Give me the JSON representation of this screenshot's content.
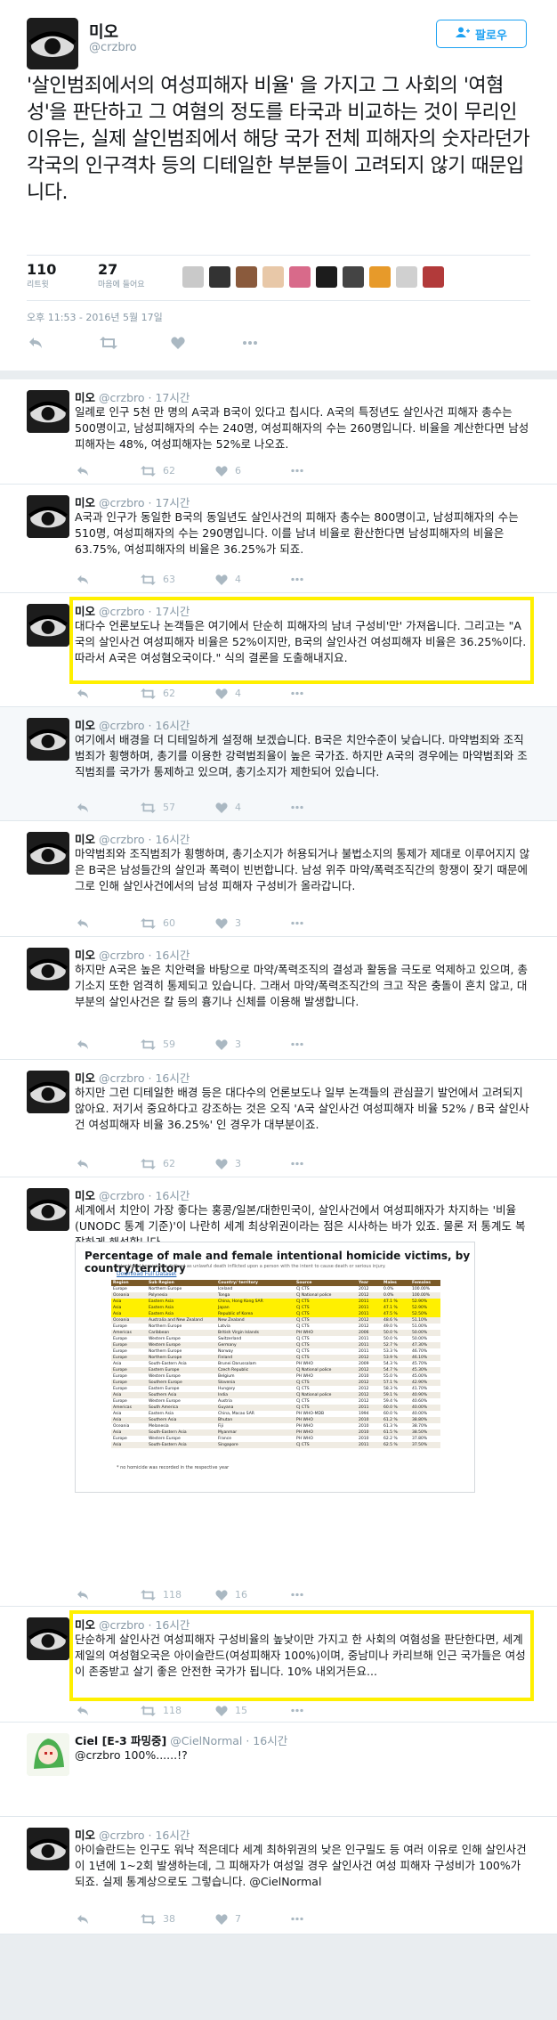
{
  "main_tweet": {
    "name": "미오",
    "handle": "@crzbro",
    "follow_label": "팔로우",
    "text": "'살인범죄에서의 여성피해자 비율' 을 가지고 그 사회의 '여혐성'을 판단하고 그 여혐의 정도를 타국과 비교하는 것이 무리인 이유는, 실제 살인범죄에서 해당 국가 전체 피해자의 숫자라던가 각국의 인구격차 등의 디테일한 부분들이 고려되지 않기 때문입니다.",
    "retweets": "110",
    "retweets_label": "리트윗",
    "likes": "27",
    "likes_label": "마음에 들어요",
    "timestamp": "오후 11:53 - 2016년 5월 17일"
  },
  "replies": [
    {
      "name": "미오",
      "handle": "@crzbro",
      "time": "· 17시간",
      "text": "일례로 인구 5천 만 명의 A국과 B국이 있다고 칩시다. A국의 특정년도 살인사건 피해자 총수는 500명이고, 남성피해자의 수는 240명, 여성피해자의 수는 260명입니다. 비율을 계산한다면 남성피해자는 48%, 여성피해자는 52%로 나오죠.",
      "rt": "62",
      "like": "6"
    },
    {
      "name": "미오",
      "handle": "@crzbro",
      "time": "· 17시간",
      "text": "A국과 인구가 동일한 B국의 동일년도 살인사건의 피해자 총수는 800명이고, 남성피해자의 수는 510명, 여성피해자의 수는 290명입니다. 이를 남녀 비율로 환산한다면 남성피해자의 비율은 63.75%, 여성피해자의 비율은 36.25%가 되죠.",
      "rt": "63",
      "like": "4"
    },
    {
      "name": "미오",
      "handle": "@crzbro",
      "time": "· 17시간",
      "text": "대다수 언론보도나 논객들은 여기에서 단순히 피해자의 남녀 구성비'만' 가져옵니다. 그리고는 \"A국의 살인사건 여성피해자 비율은 52%이지만, B국의 살인사건 여성피해자 비율은 36.25%이다. 따라서 A국은 여성혐오국이다.\" 식의 결론을 도출해내지요.",
      "rt": "62",
      "like": "4"
    },
    {
      "name": "미오",
      "handle": "@crzbro",
      "time": "· 16시간",
      "text": "여기에서 배경을 더 디테일하게 설정해 보겠습니다. B국은 치안수준이 낮습니다. 마약범죄와 조직범죄가 횡행하며, 총기를 이용한 강력범죄율이 높은 국가죠. 하지만 A국의 경우에는 마약범죄와 조직범죄를 국가가 통제하고 있으며, 총기소지가 제한되어 있습니다.",
      "rt": "57",
      "like": "4"
    },
    {
      "name": "미오",
      "handle": "@crzbro",
      "time": "· 16시간",
      "text": "마약범죄와 조직범죄가 횡행하며, 총기소지가 허용되거나 불법소지의 통제가 제대로 이루어지지 않은 B국은 남성들간의 살인과 폭력이 빈번합니다. 남성 위주 마약/폭력조직간의 항쟁이 잦기 때문에 그로 인해 살인사건에서의 남성 피해자 구성비가 올라갑니다.",
      "rt": "60",
      "like": "3"
    },
    {
      "name": "미오",
      "handle": "@crzbro",
      "time": "· 16시간",
      "text": "하지만 A국은 높은 치안력을 바탕으로 마약/폭력조직의 결성과 활동을 극도로 억제하고 있으며, 총기소지 또한 엄격히 통제되고 있습니다. 그래서 마약/폭력조직간의 크고 작은 충돌이 흔치 않고, 대부분의 살인사건은 칼 등의 흉기나 신체를 이용해 발생합니다.",
      "rt": "59",
      "like": "3"
    },
    {
      "name": "미오",
      "handle": "@crzbro",
      "time": "· 16시간",
      "text": "하지만 그런 디테일한 배경 등은 대다수의 언론보도나 일부 논객들의 관심끌기 발언에서 고려되지 않아요. 저기서 중요하다고 강조하는 것은 오직 'A국 살인사건 여성피해자 비율 52% / B국 살인사건 여성피해자 비율 36.25%' 인 경우가 대부분이죠.",
      "rt": "62",
      "like": "3"
    },
    {
      "name": "미오",
      "handle": "@crzbro",
      "time": "· 16시간",
      "text": "세계에서 치안이 가장 좋다는 홍콩/일본/대한민국이, 살인사건에서 여성피해자가 차지하는 '비율(UNODC 통계 기준)'이 나란히 세계 최상위권이라는 점은 시사하는 바가 있죠. 물론 저 통계도 복잡하게 해석합니다",
      "rt": "118",
      "like": "16"
    },
    {
      "name": "미오",
      "handle": "@crzbro",
      "time": "· 16시간",
      "text": "단순하게 살인사건 여성피해자 구성비율의 높낮이만 가지고 한 사회의 여혐성을 판단한다면, 세계 제일의 여성혐오국은 아이슬란드(여성피해자 100%)이며, 중남미나 카리브해 인근 국가들은 여성이 존중받고 살기 좋은 안전한 국가가 됩니다. 10% 내외거든요...",
      "rt": "118",
      "like": "15"
    },
    {
      "name": "Ciel [E-3 파밍중]",
      "handle": "@CielNormal",
      "time": "· 16시간",
      "text": "@crzbro 100%......!?",
      "rt": "",
      "like": ""
    },
    {
      "name": "미오",
      "handle": "@crzbro",
      "time": "· 16시간",
      "text": "아이슬란드는 인구도 워낙 적은데다 세계 최하위권의 낮은 인구밀도 등 여러 이유로 인해 살인사건이 1년에 1~2회 발생하는데, 그 피해자가 여성일 경우 살인사건 여성 피해자 구성비가 100%가 되죠. 실제 통계상으로도 그렇습니다. @CielNormal",
      "rt": "38",
      "like": "7"
    }
  ],
  "table": {
    "title": "Percentage of male and female intentional homicide victims, by country/territory",
    "subtitle": "Intentional homicide is defined as unlawful death inflicted upon a person with the intent to cause death or serious injury.",
    "download": "Download Full Dataset",
    "headers": [
      "Region",
      "Sub Region",
      "Country/ territory",
      "Source",
      "Year",
      "Males",
      "Females"
    ],
    "rows": [
      [
        "Europe",
        "Northern Europe",
        "Iceland",
        "CJ CTS",
        "2012",
        "0.0%",
        "100.00%"
      ],
      [
        "Oceania",
        "Polynesia",
        "Tonga",
        "CJ National police",
        "2012",
        "0.0%",
        "100.00%"
      ],
      [
        "Asia",
        "Eastern Asia",
        "China, Hong Kong SAR",
        "CJ CTS",
        "2011",
        "47.1 %",
        "52.90%"
      ],
      [
        "Asia",
        "Eastern Asia",
        "Japan",
        "CJ CTS",
        "2011",
        "47.1 %",
        "52.90%"
      ],
      [
        "Asia",
        "Eastern Asia",
        "Republic of Korea",
        "CJ CTS",
        "2011",
        "47.5 %",
        "52.50%"
      ],
      [
        "Oceania",
        "Australia and New Zealand",
        "New Zealand",
        "CJ CTS",
        "2012",
        "48.6 %",
        "51.10%"
      ],
      [
        "Europe",
        "Northern Europe",
        "Latvia",
        "CJ CTS",
        "2012",
        "49.0 %",
        "51.00%"
      ],
      [
        "Americas",
        "Caribbean",
        "British Virgin Islands",
        "PH WHO",
        "2006",
        "50.0 %",
        "50.00%"
      ],
      [
        "Europe",
        "Western Europe",
        "Switzerland",
        "CJ CTS",
        "2011",
        "50.0 %",
        "50.00%"
      ],
      [
        "Europe",
        "Western Europe",
        "Germany",
        "CJ CTS",
        "2011",
        "52.7 %",
        "47.30%"
      ],
      [
        "Europe",
        "Northern Europe",
        "Norway",
        "CJ CTS",
        "2011",
        "53.3 %",
        "46.70%"
      ],
      [
        "Europe",
        "Northern Europe",
        "Finland",
        "CJ CTS",
        "2012",
        "53.9 %",
        "46.10%"
      ],
      [
        "Asia",
        "South-Eastern Asia",
        "Brunei Darussalam",
        "PH WHO",
        "2009",
        "54.3 %",
        "45.70%"
      ],
      [
        "Europe",
        "Eastern Europe",
        "Czech Republic",
        "CJ National police",
        "2012",
        "54.7 %",
        "45.30%"
      ],
      [
        "Europe",
        "Western Europe",
        "Belgium",
        "PH WHO",
        "2010",
        "55.0 %",
        "45.00%"
      ],
      [
        "Europe",
        "Southern Europe",
        "Slovenia",
        "CJ CTS",
        "2012",
        "57.1 %",
        "42.90%"
      ],
      [
        "Europe",
        "Eastern Europe",
        "Hungary",
        "CJ CTS",
        "2012",
        "58.3 %",
        "41.70%"
      ],
      [
        "Asia",
        "Southern Asia",
        "India",
        "CJ National police",
        "2012",
        "59.1 %",
        "40.90%"
      ],
      [
        "Europe",
        "Western Europe",
        "Austria",
        "CJ CTS",
        "2012",
        "59.4 %",
        "40.60%"
      ],
      [
        "Americas",
        "South America",
        "Guyana",
        "CJ CTS",
        "2011",
        "60.0 %",
        "40.00%"
      ],
      [
        "Asia",
        "Eastern Asia",
        "China, Macao SAR",
        "PH WHO-MDB",
        "1994",
        "60.0 %",
        "40.00%"
      ],
      [
        "Asia",
        "Southern Asia",
        "Bhutan",
        "PH WHO",
        "2010",
        "61.2 %",
        "38.80%"
      ],
      [
        "Oceania",
        "Melanesia",
        "Fiji",
        "PH WHO",
        "2010",
        "61.3 %",
        "38.70%"
      ],
      [
        "Asia",
        "South-Eastern Asia",
        "Myanmar",
        "PH WHO",
        "2010",
        "61.5 %",
        "38.50%"
      ],
      [
        "Europe",
        "Western Europe",
        "France",
        "PH WHO",
        "2010",
        "62.2 %",
        "37.80%"
      ],
      [
        "Asia",
        "South-Eastern Asia",
        "Singapore",
        "CJ CTS",
        "2011",
        "62.5 %",
        "37.50%"
      ]
    ],
    "note": "* no homicide was recorded in the respective year"
  }
}
